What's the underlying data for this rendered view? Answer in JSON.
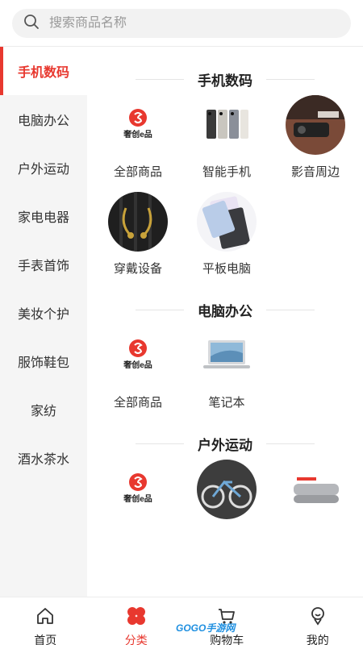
{
  "search": {
    "placeholder": "搜索商品名称"
  },
  "sidebar": {
    "items": [
      {
        "label": "手机数码",
        "active": true
      },
      {
        "label": "电脑办公"
      },
      {
        "label": "户外运动"
      },
      {
        "label": "家电电器"
      },
      {
        "label": "手表首饰"
      },
      {
        "label": "美妆个护"
      },
      {
        "label": "服饰鞋包"
      },
      {
        "label": "家纺"
      },
      {
        "label": "酒水茶水"
      }
    ]
  },
  "sections": [
    {
      "title": "手机数码",
      "items": [
        {
          "label": "全部商品",
          "icon": "brand-logo"
        },
        {
          "label": "智能手机",
          "icon": "phones"
        },
        {
          "label": "影音周边",
          "icon": "audio-device"
        },
        {
          "label": "穿戴设备",
          "icon": "earphones"
        },
        {
          "label": "平板电脑",
          "icon": "tablet"
        }
      ]
    },
    {
      "title": "电脑办公",
      "items": [
        {
          "label": "全部商品",
          "icon": "brand-logo"
        },
        {
          "label": "笔记本",
          "icon": "laptop"
        }
      ]
    },
    {
      "title": "户外运动",
      "items": [
        {
          "label": "",
          "icon": "brand-logo"
        },
        {
          "label": "",
          "icon": "bicycle"
        },
        {
          "label": "",
          "icon": "sleeping-bag"
        }
      ]
    }
  ],
  "brand": {
    "logo_text": "奢创e品"
  },
  "tabbar": {
    "items": [
      {
        "label": "首页",
        "icon": "home-icon"
      },
      {
        "label": "分类",
        "icon": "category-icon",
        "active": true
      },
      {
        "label": "购物车",
        "icon": "cart-icon"
      },
      {
        "label": "我的",
        "icon": "profile-icon"
      }
    ]
  },
  "watermark": "GOGO手游网",
  "colors": {
    "accent": "#e8382f",
    "sidebar_bg": "#f5f5f5",
    "search_bg": "#f2f2f2"
  }
}
